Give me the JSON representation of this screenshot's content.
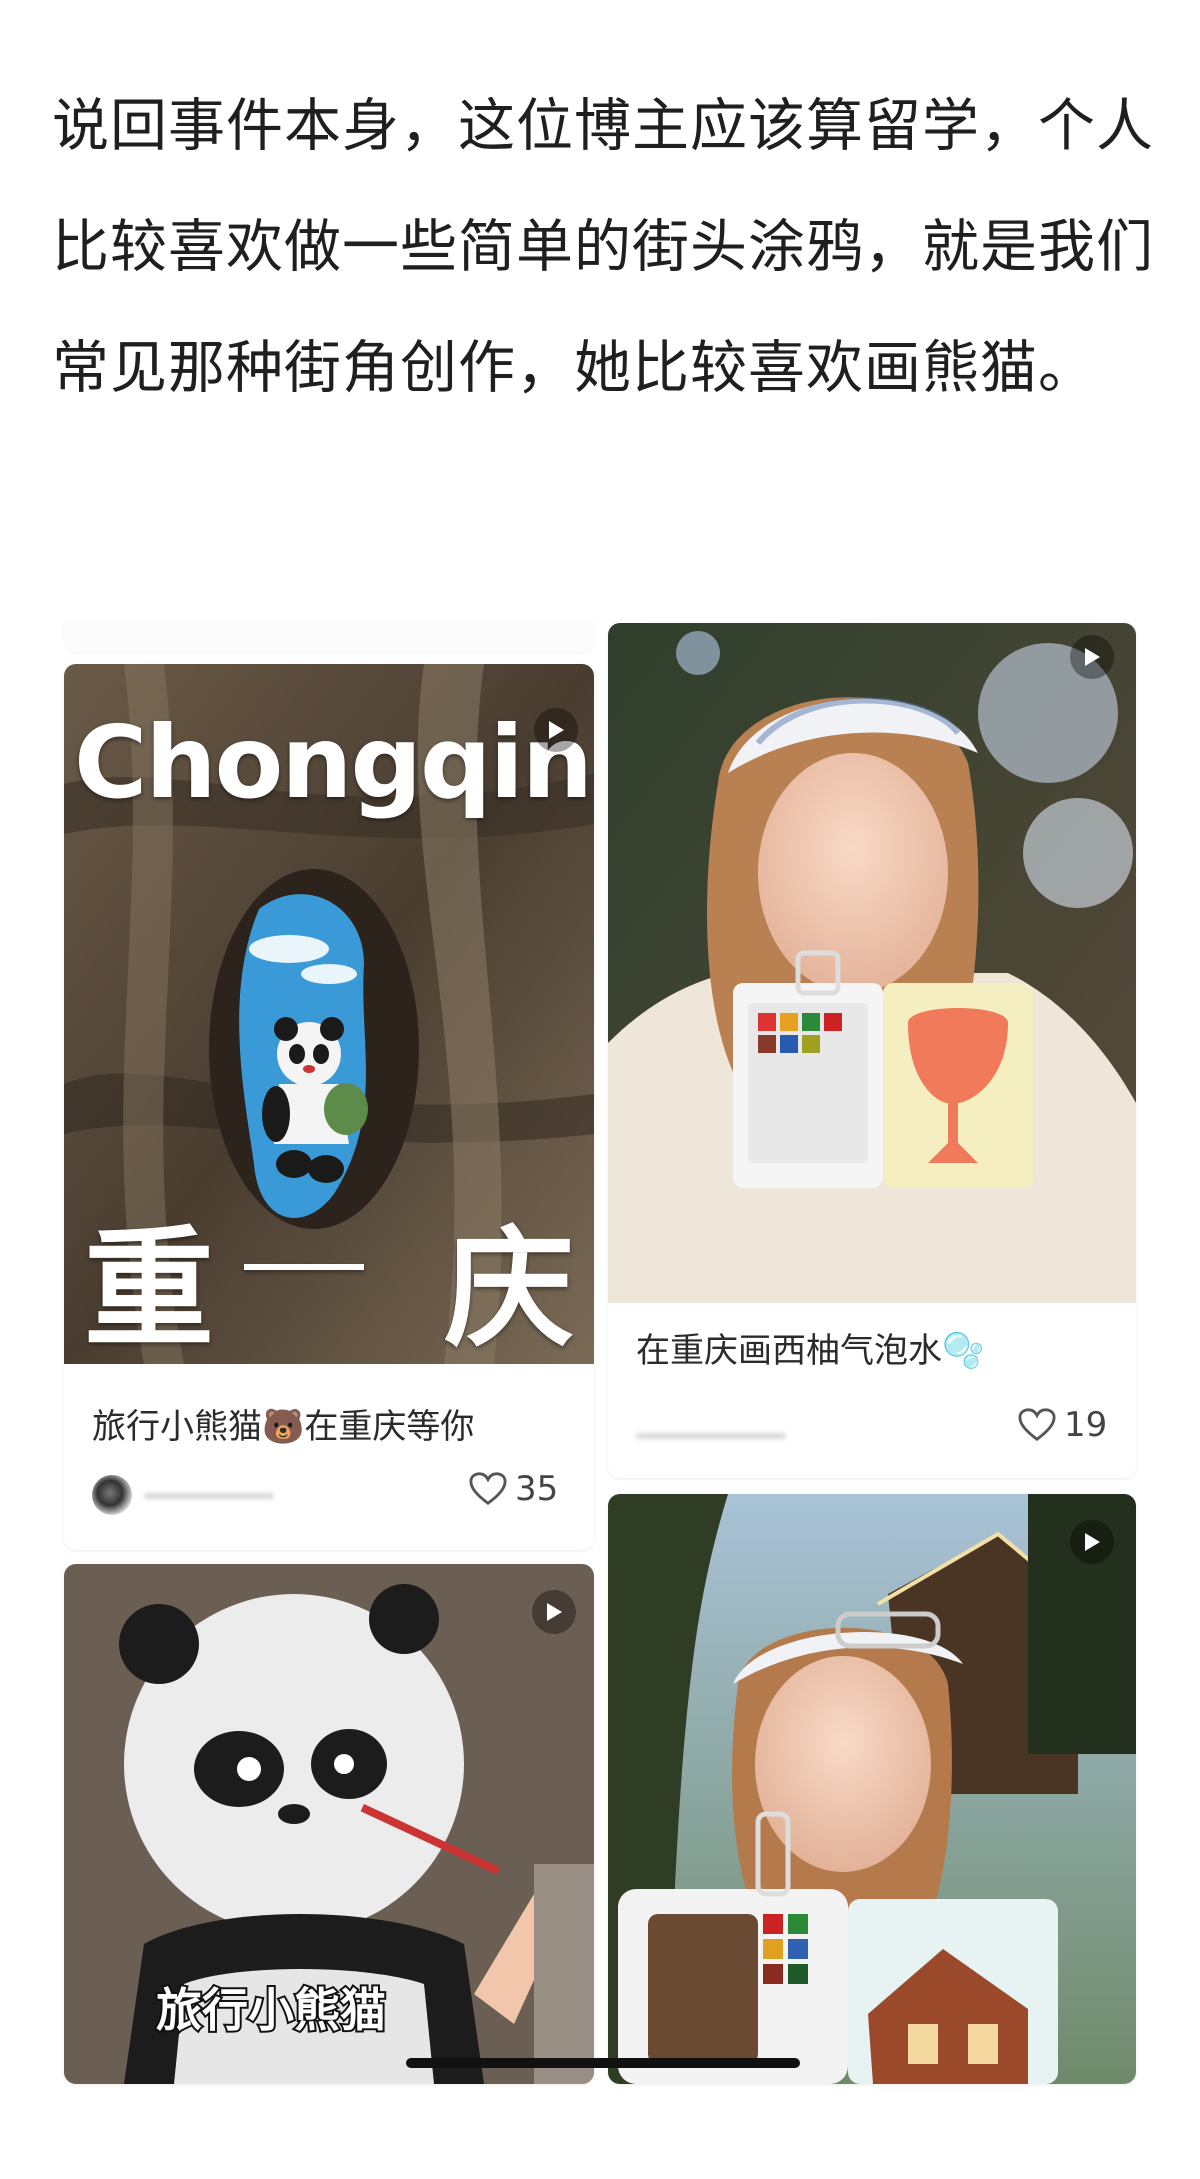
{
  "article": {
    "paragraph": "说回事件本身，这位博主应该算留学，个人比较喜欢做一些简单的街头涂鸦，就是我们常见那种街角创作，她比较喜欢画熊猫。"
  },
  "cards": [
    {
      "title": "旅行小熊猫🐻在重庆等你",
      "likes": "35",
      "overlay_word": "Chongqing",
      "overlay_left_char": "重",
      "overlay_right_char": "庆",
      "icon": "play-icon"
    },
    {
      "title": "在重庆画西柚气泡水🫧",
      "likes": "19",
      "icon": "play-icon"
    },
    {
      "sticker": "旅行小熊猫",
      "icon": "play-icon"
    },
    {
      "icon": "play-icon"
    }
  ],
  "colors": {
    "text": "#1f1f1f",
    "card_bg": "#ffffff",
    "like": "#444444"
  }
}
